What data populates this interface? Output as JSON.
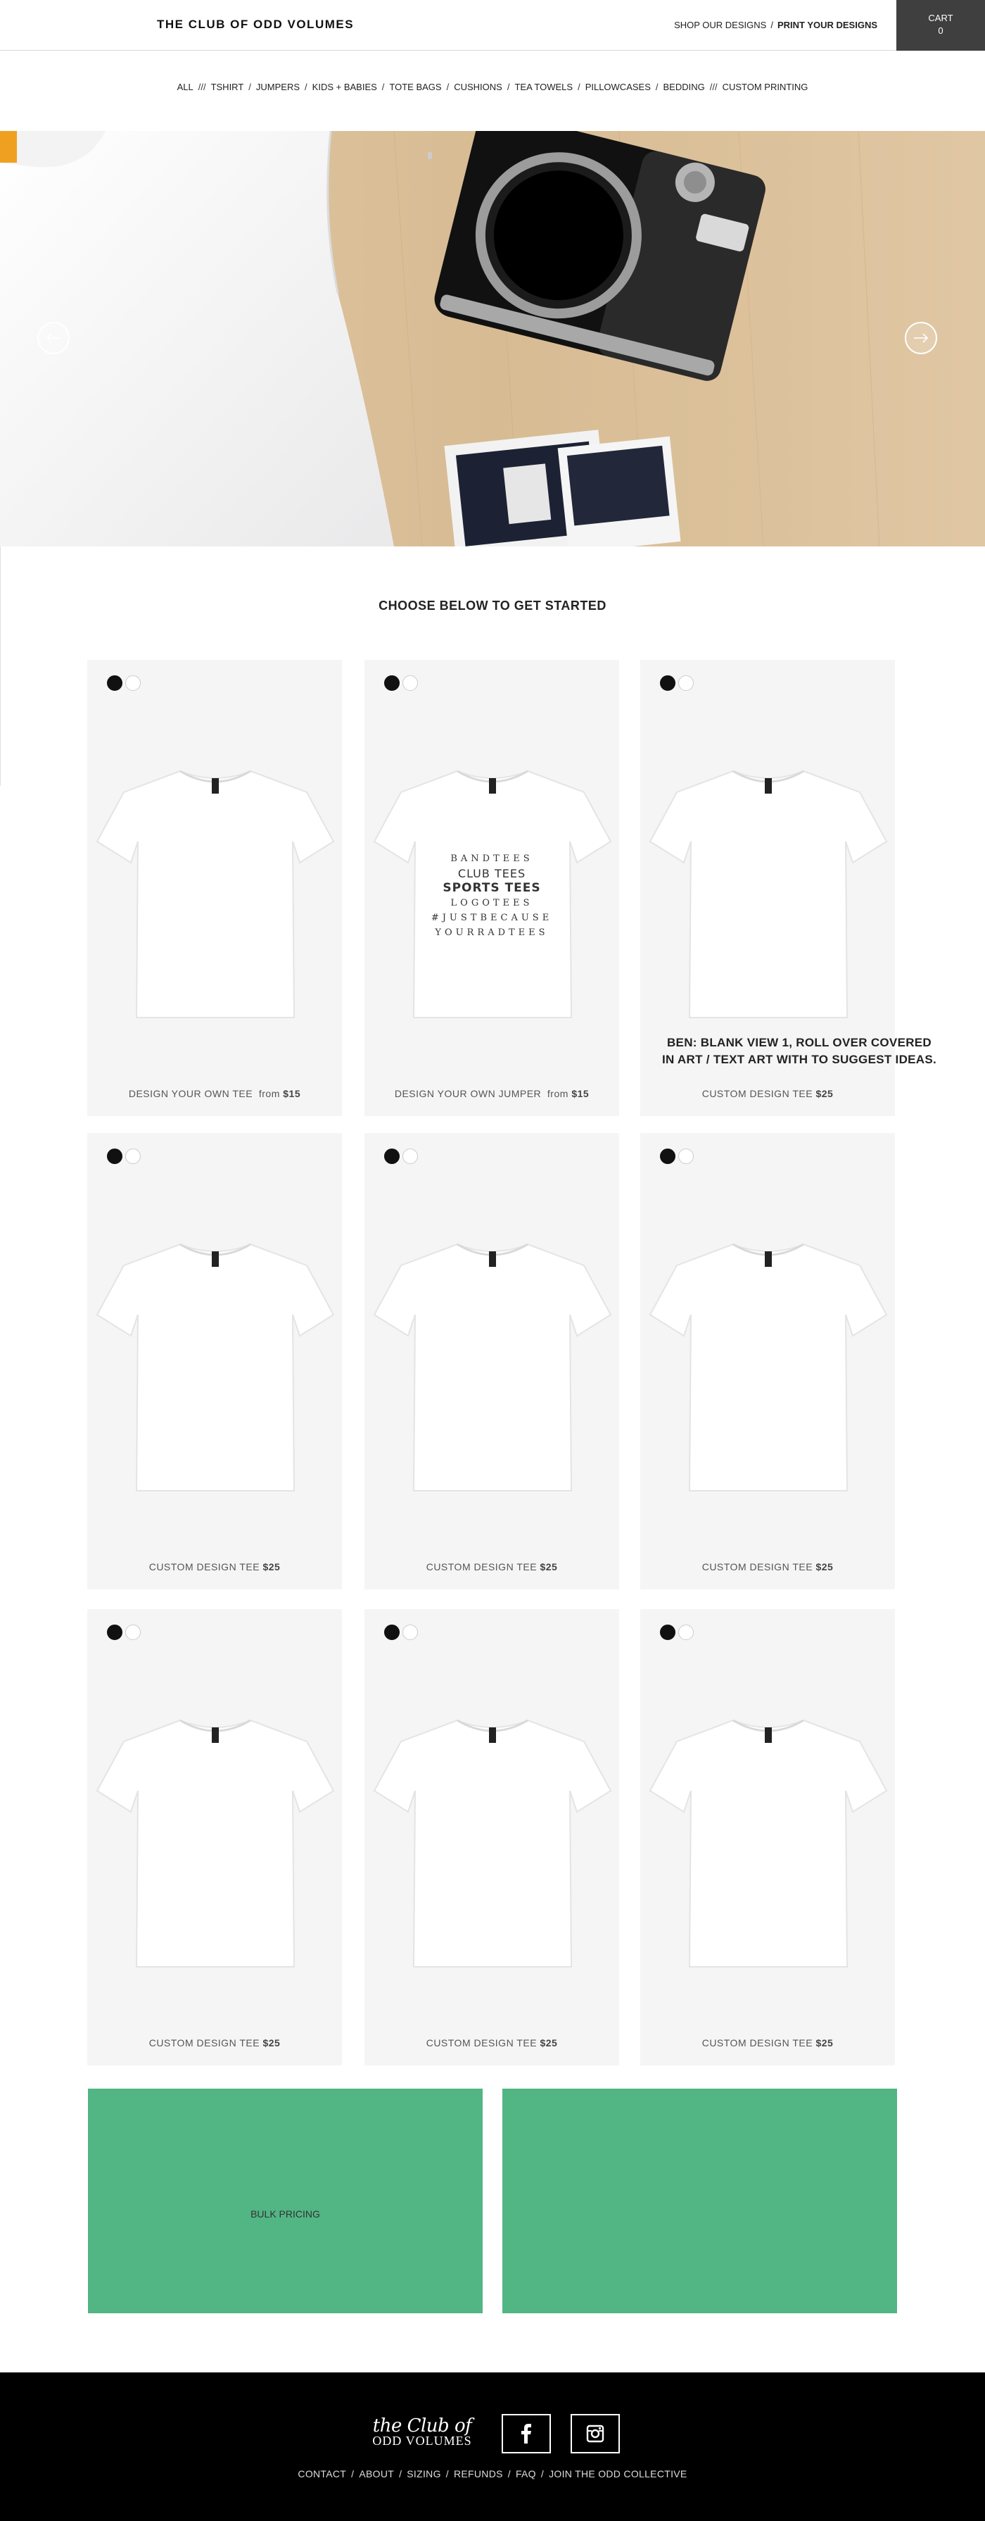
{
  "header": {
    "brand": "THE CLUB OF ODD VOLUMES",
    "nav": {
      "shop": "SHOP OUR DESIGNS",
      "separator": "/",
      "print": "PRINT YOUR DESIGNS"
    },
    "cart": {
      "label": "CART",
      "count": "0"
    }
  },
  "categories": {
    "items": [
      "ALL",
      "TSHIRT",
      "JUMPERS",
      "KIDS + BABIES",
      "TOTE BAGS",
      "CUSHIONS",
      "TEA TOWELS",
      "PILLOWCASES",
      "BEDDING",
      "CUSTOM PRINTING"
    ],
    "separators": [
      "///",
      "/",
      "/",
      "/",
      "/",
      "/",
      "/",
      "/",
      "///"
    ]
  },
  "hero": {
    "prev_icon": "arrow-left-icon",
    "next_icon": "arrow-right-icon"
  },
  "section_title": "CHOOSE BELOW TO GET STARTED",
  "products": [
    {
      "name": "DESIGN YOUR OWN TEE",
      "price_prefix": "from",
      "price": "$15"
    },
    {
      "name": "DESIGN YOUR OWN JUMPER",
      "price_prefix": "from",
      "price": "$15",
      "print_lines": [
        "BANDTEES",
        "CLUB TEES",
        "SPORTS TEES",
        "LOGOTEES",
        "#JUSTBECAUSE",
        "YOURRADTEES"
      ]
    },
    {
      "name": "CUSTOM DESIGN TEE",
      "price_prefix": "",
      "price": "$25"
    },
    {
      "name": "CUSTOM DESIGN TEE",
      "price_prefix": "",
      "price": "$25"
    },
    {
      "name": "CUSTOM DESIGN TEE",
      "price_prefix": "",
      "price": "$25"
    },
    {
      "name": "CUSTOM DESIGN TEE",
      "price_prefix": "",
      "price": "$25"
    },
    {
      "name": "CUSTOM DESIGN TEE",
      "price_prefix": "",
      "price": "$25"
    },
    {
      "name": "CUSTOM DESIGN TEE",
      "price_prefix": "",
      "price": "$25"
    },
    {
      "name": "CUSTOM DESIGN TEE",
      "price_prefix": "",
      "price": "$25"
    }
  ],
  "note": {
    "line1": "BEN: BLANK VIEW 1, ROLL OVER COVERED",
    "line2": "IN ART / TEXT ART WITH TO SUGGEST IDEAS."
  },
  "promo": {
    "left_label": "BULK PRICING",
    "right_label": ""
  },
  "footer": {
    "logo_script": "the Club of",
    "logo_caps": "ODD VOLUMES",
    "links": [
      "CONTACT",
      "ABOUT",
      "SIZING",
      "REFUNDS",
      "FAQ",
      "JOIN THE ODD COLLECTIVE"
    ],
    "link_separator": "/",
    "social": [
      "facebook-icon",
      "instagram-icon"
    ]
  },
  "colors": {
    "accent_green": "#52b584",
    "cart_bg": "#3f3f3f",
    "card_bg": "#f5f5f5",
    "footer_bg": "#000000"
  }
}
